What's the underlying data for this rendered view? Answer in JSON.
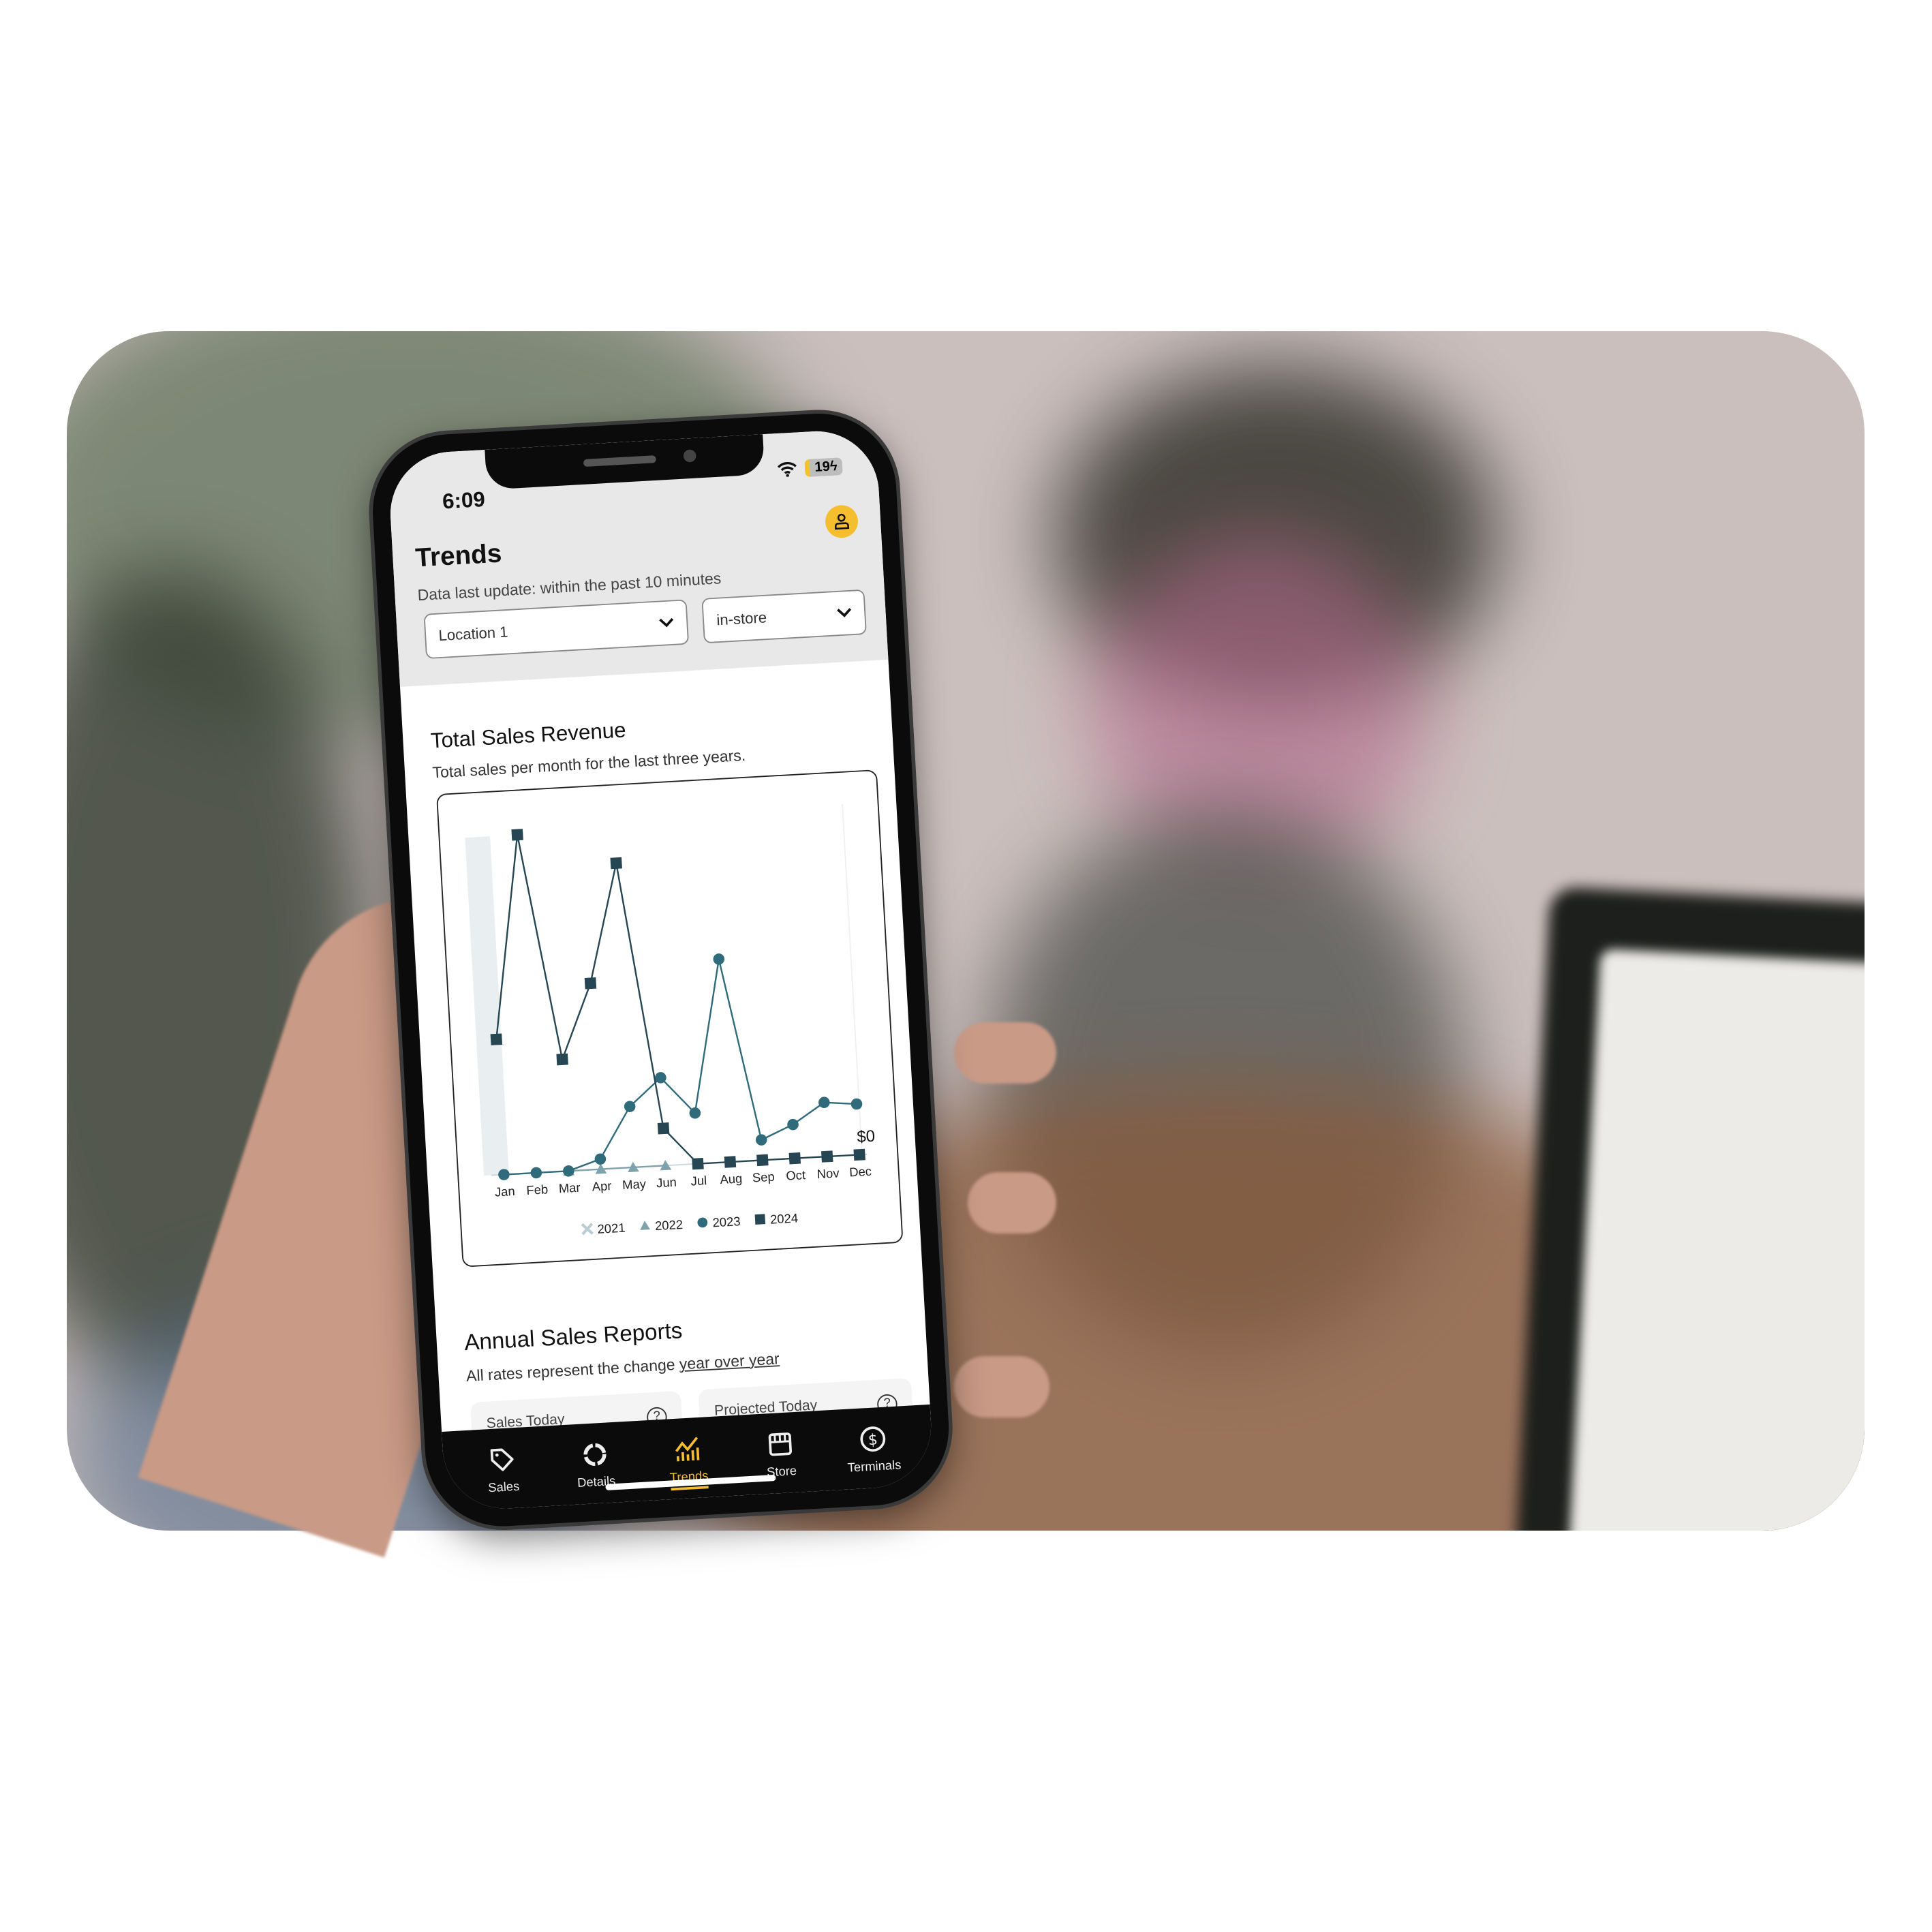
{
  "status_bar": {
    "time": "6:09",
    "battery": "19",
    "charging_icon": "bolt-icon",
    "wifi_icon": "wifi-icon"
  },
  "header": {
    "title": "Trends",
    "subtitle": "Data last update: within the past 10 minutes",
    "profile_icon": "user-icon",
    "location_select": {
      "value": "Location 1"
    },
    "channel_select": {
      "value": "in-store"
    }
  },
  "revenue": {
    "title": "Total Sales Revenue",
    "subtitle": "Total sales per month for the last three years."
  },
  "chart_data": {
    "type": "line",
    "title": "",
    "categories": [
      "Jan",
      "Feb",
      "Mar",
      "Apr",
      "May",
      "Jun",
      "Jul",
      "Aug",
      "Sep",
      "Oct",
      "Nov",
      "Dec"
    ],
    "y_label_text": "$0",
    "ylim": [
      0,
      100
    ],
    "y_units": "relative (unlabeled except $0)",
    "grid": false,
    "legend_position": "bottom",
    "highlighted_category": "Jan",
    "series": [
      {
        "name": "2021",
        "marker": "x",
        "color": "#b9cdd2",
        "values": [
          null,
          null,
          null,
          null,
          null,
          null,
          null,
          null,
          null,
          null,
          null,
          null
        ]
      },
      {
        "name": "2022",
        "marker": "triangle",
        "color": "#7fa3ad",
        "values": [
          null,
          null,
          0,
          0,
          0,
          0,
          null,
          null,
          null,
          null,
          null,
          null
        ]
      },
      {
        "name": "2023",
        "marker": "circle",
        "color": "#2f6b7a",
        "values": [
          0,
          0,
          0,
          3,
          18,
          26,
          15,
          60,
          6,
          10,
          16,
          15
        ]
      },
      {
        "name": "2024",
        "marker": "square",
        "color": "#264653",
        "values": [
          40,
          100,
          33,
          55,
          90,
          11,
          0,
          0,
          0,
          0,
          0,
          0
        ]
      }
    ]
  },
  "annual": {
    "title": "Annual Sales Reports",
    "subtitle_prefix": "All rates represent the change ",
    "subtitle_link": "year over year",
    "cards": [
      {
        "label": "Sales Today",
        "help_icon": "question-icon"
      },
      {
        "label": "Projected Today",
        "help_icon": "question-icon"
      }
    ]
  },
  "tabbar": {
    "active": "Trends",
    "accent": "#f5be2e",
    "items": [
      {
        "label": "Sales",
        "icon": "tag-icon"
      },
      {
        "label": "Details",
        "icon": "ring-icon"
      },
      {
        "label": "Trends",
        "icon": "chart-icon"
      },
      {
        "label": "Store",
        "icon": "store-icon"
      },
      {
        "label": "Terminals",
        "icon": "dollar-circle-icon"
      }
    ]
  }
}
